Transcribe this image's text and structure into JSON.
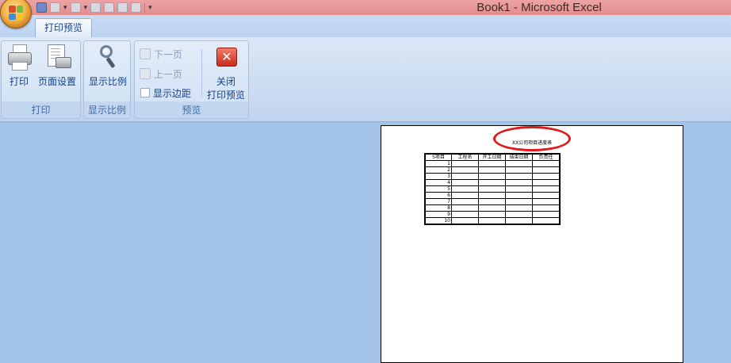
{
  "window": {
    "title": "Book1 - Microsoft Excel"
  },
  "quick_access": {
    "icons": [
      "save-icon",
      "undo-icon",
      "redo-icon",
      "print-preview-icon",
      "spelling-icon",
      "sort-icon",
      "customize-icon"
    ]
  },
  "tabs": {
    "active": "打印预览"
  },
  "ribbon": {
    "groups": {
      "print": {
        "label": "打印",
        "print_button": "打印",
        "page_setup_button": "页面设置"
      },
      "zoom": {
        "label": "显示比例",
        "zoom_button": "显示比例"
      },
      "preview": {
        "label": "预览",
        "next_page": "下一页",
        "prev_page": "上一页",
        "show_margins": "显示边距",
        "close_line1": "关闭",
        "close_line2": "打印预览"
      }
    }
  },
  "sheet": {
    "title": "XX公司项目进度表",
    "headers": [
      "S项目",
      "工程名",
      "开工日期",
      "结束日期",
      "负责任"
    ],
    "rows": [
      "1",
      "2",
      "3",
      "4",
      "5",
      "6",
      "7",
      "8",
      "9",
      "10"
    ]
  },
  "colors": {
    "titlebar": "#e48d8d",
    "ribbon": "#c9daf1",
    "workspace": "#a4c3e8",
    "annotation": "#e01b1b"
  }
}
